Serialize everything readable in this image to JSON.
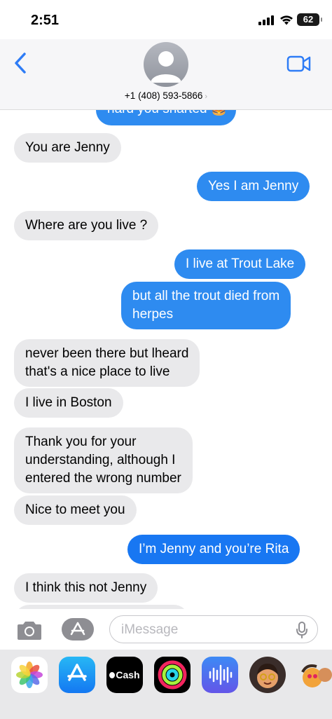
{
  "status_bar": {
    "time": "2:51",
    "battery": "62"
  },
  "header": {
    "contact": "+1 (408) 593-5866",
    "chevron": "›"
  },
  "messages": [
    {
      "dir": "out",
      "text": "hard you sharted 🍔"
    },
    {
      "dir": "in",
      "text": "You are Jenny"
    },
    {
      "dir": "out",
      "text": "Yes I am Jenny"
    },
    {
      "dir": "in",
      "text": "Where are you live ?"
    },
    {
      "dir": "out",
      "text": "I live at Trout Lake"
    },
    {
      "dir": "out",
      "text_lines": [
        "but all the trout died from",
        "herpes"
      ]
    },
    {
      "dir": "in",
      "text_lines": [
        "never been there but lheard",
        "that's a nice place to live"
      ]
    },
    {
      "dir": "in",
      "text": "I live in Boston"
    },
    {
      "dir": "in",
      "text_lines": [
        "Thank you for your",
        "understanding, although I",
        "entered the wrong number"
      ]
    },
    {
      "dir": "in",
      "text": "Nice to meet you"
    },
    {
      "dir": "out",
      "text": "I’m Jenny and you’re Rita"
    },
    {
      "dir": "in",
      "text": "I think this not Jenny"
    }
  ],
  "composer": {
    "placeholder": "iMessage"
  },
  "app_tray": {
    "items": [
      "Photos",
      "App Store",
      "Cash",
      "Fitness",
      "Audio Message",
      "Memoji",
      "Memoji Stickers"
    ],
    "cash_label": "Cash"
  },
  "colors": {
    "outgoing": "#2e8bf0",
    "incoming": "#e9e9eb",
    "accent": "#2e7cf6"
  }
}
